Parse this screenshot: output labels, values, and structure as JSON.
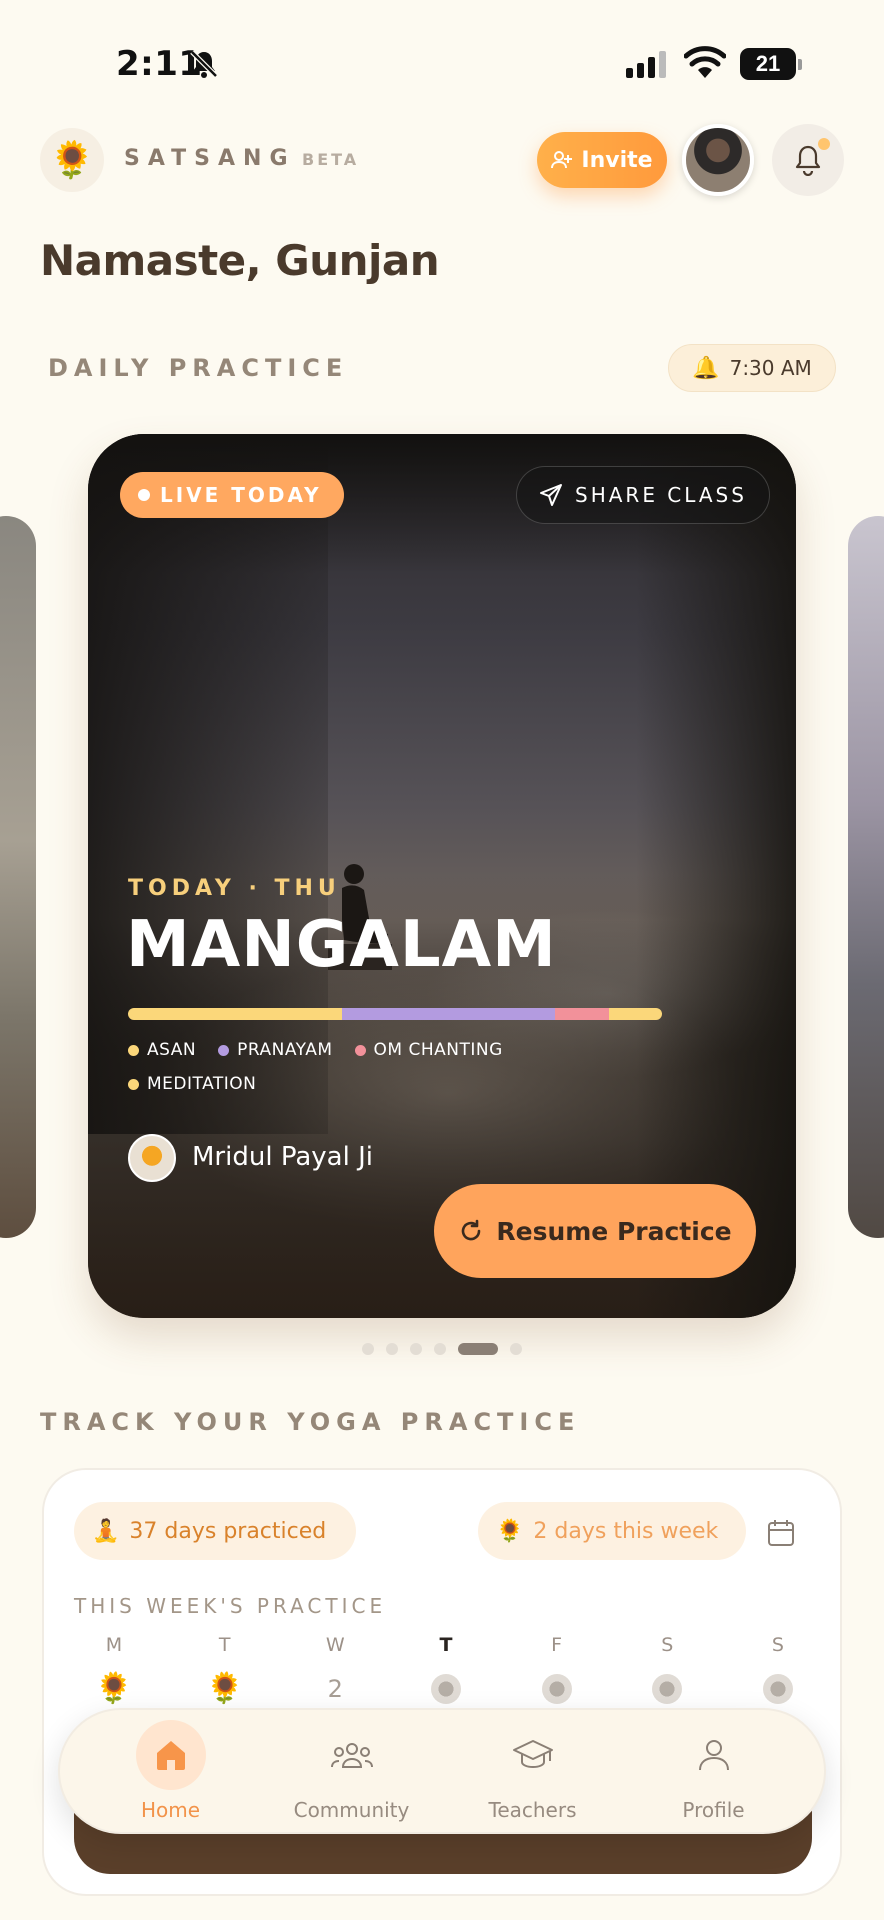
{
  "status_bar": {
    "time": "2:11",
    "battery": "21"
  },
  "header": {
    "logo_emoji": "🌻",
    "brand": "SATSANG",
    "beta": "BETA",
    "invite_label": "Invite"
  },
  "greeting": "Namaste, Gunjan",
  "daily_practice": {
    "section_label": "DAILY PRACTICE",
    "reminder_time": "7:30 AM",
    "card": {
      "live_label": "LIVE TODAY",
      "share_label": "SHARE CLASS",
      "day_label": "TODAY · THU",
      "title": "MANGALAM",
      "segments": [
        {
          "name": "ASAN",
          "color": "#fbd77a",
          "fraction": 0.4
        },
        {
          "name": "PRANAYAM",
          "color": "#b39be0",
          "fraction": 0.4
        },
        {
          "name": "OM CHANTING",
          "color": "#f2919a",
          "fraction": 0.1
        },
        {
          "name": "MEDITATION",
          "color": "#fbd77a",
          "fraction": 0.1
        }
      ],
      "teacher": "Mridul Payal Ji",
      "resume_label": "Resume Practice"
    },
    "carousel": {
      "count": 6,
      "active_index": 4
    }
  },
  "tracker": {
    "section_label": "TRACK YOUR YOGA PRACTICE",
    "days_practiced": "37 days practiced",
    "this_week": "2 days this week",
    "week_label": "THIS WEEK'S PRACTICE",
    "days": [
      {
        "letter": "M",
        "state": "done"
      },
      {
        "letter": "T",
        "state": "done"
      },
      {
        "letter": "W",
        "state": "number",
        "value": "2"
      },
      {
        "letter": "T",
        "state": "upcoming",
        "today": true
      },
      {
        "letter": "F",
        "state": "upcoming"
      },
      {
        "letter": "S",
        "state": "upcoming"
      },
      {
        "letter": "S",
        "state": "upcoming"
      }
    ]
  },
  "nav": {
    "home": "Home",
    "community": "Community",
    "teachers": "Teachers",
    "profile": "Profile"
  }
}
